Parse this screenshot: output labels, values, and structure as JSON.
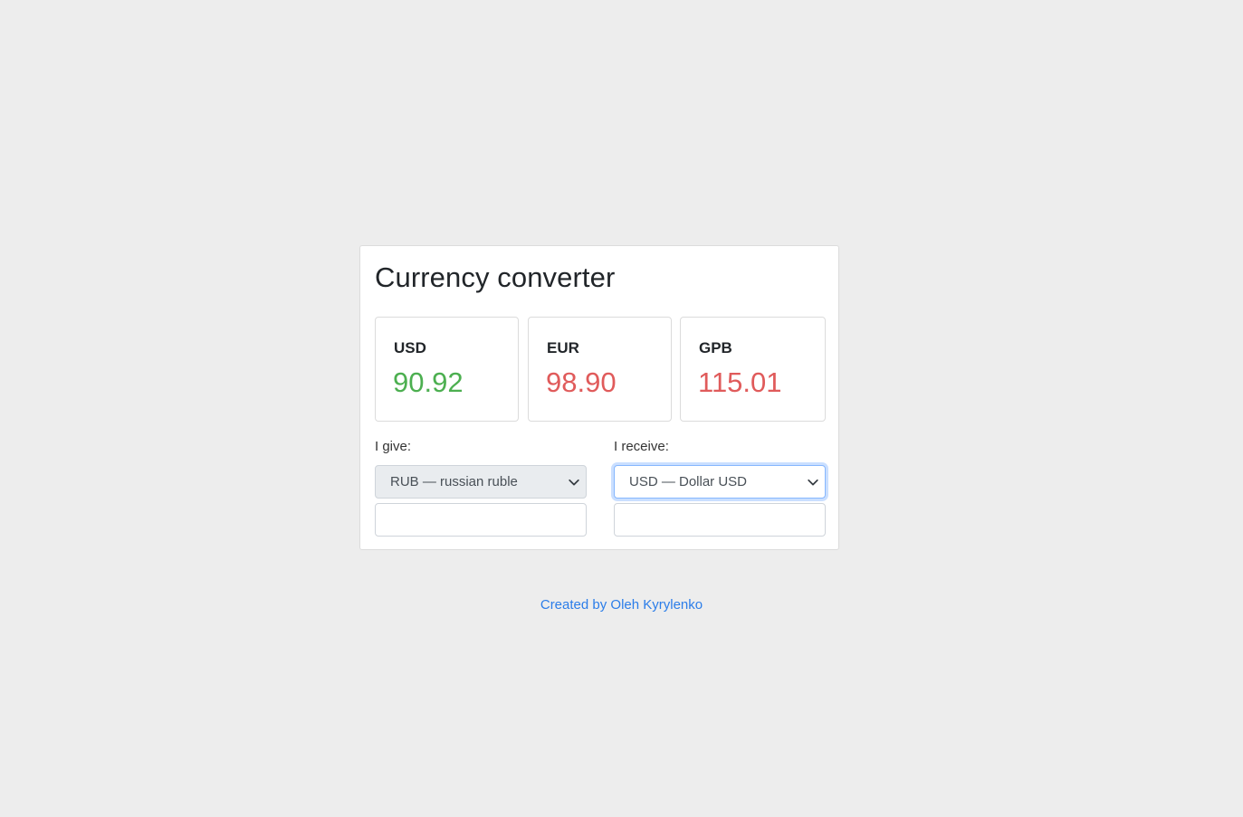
{
  "app": {
    "title": "Currency converter"
  },
  "rates": [
    {
      "code": "USD",
      "value": "90.92",
      "color": "#4caf50"
    },
    {
      "code": "EUR",
      "value": "98.90",
      "color": "#e05b5b"
    },
    {
      "code": "GPB",
      "value": "115.01",
      "color": "#e05b5b"
    }
  ],
  "give": {
    "label": "I give:",
    "selected": "RUB — russian ruble",
    "amount": ""
  },
  "receive": {
    "label": "I receive:",
    "selected": "USD — Dollar USD",
    "amount": ""
  },
  "footer": {
    "credit": "Created by Oleh Kyrylenko"
  },
  "colors": {
    "background": "#ededed",
    "card": "#ffffff",
    "link": "#2b7de9",
    "up": "#4caf50",
    "down": "#e05b5b",
    "focus": "#86b7fe"
  }
}
